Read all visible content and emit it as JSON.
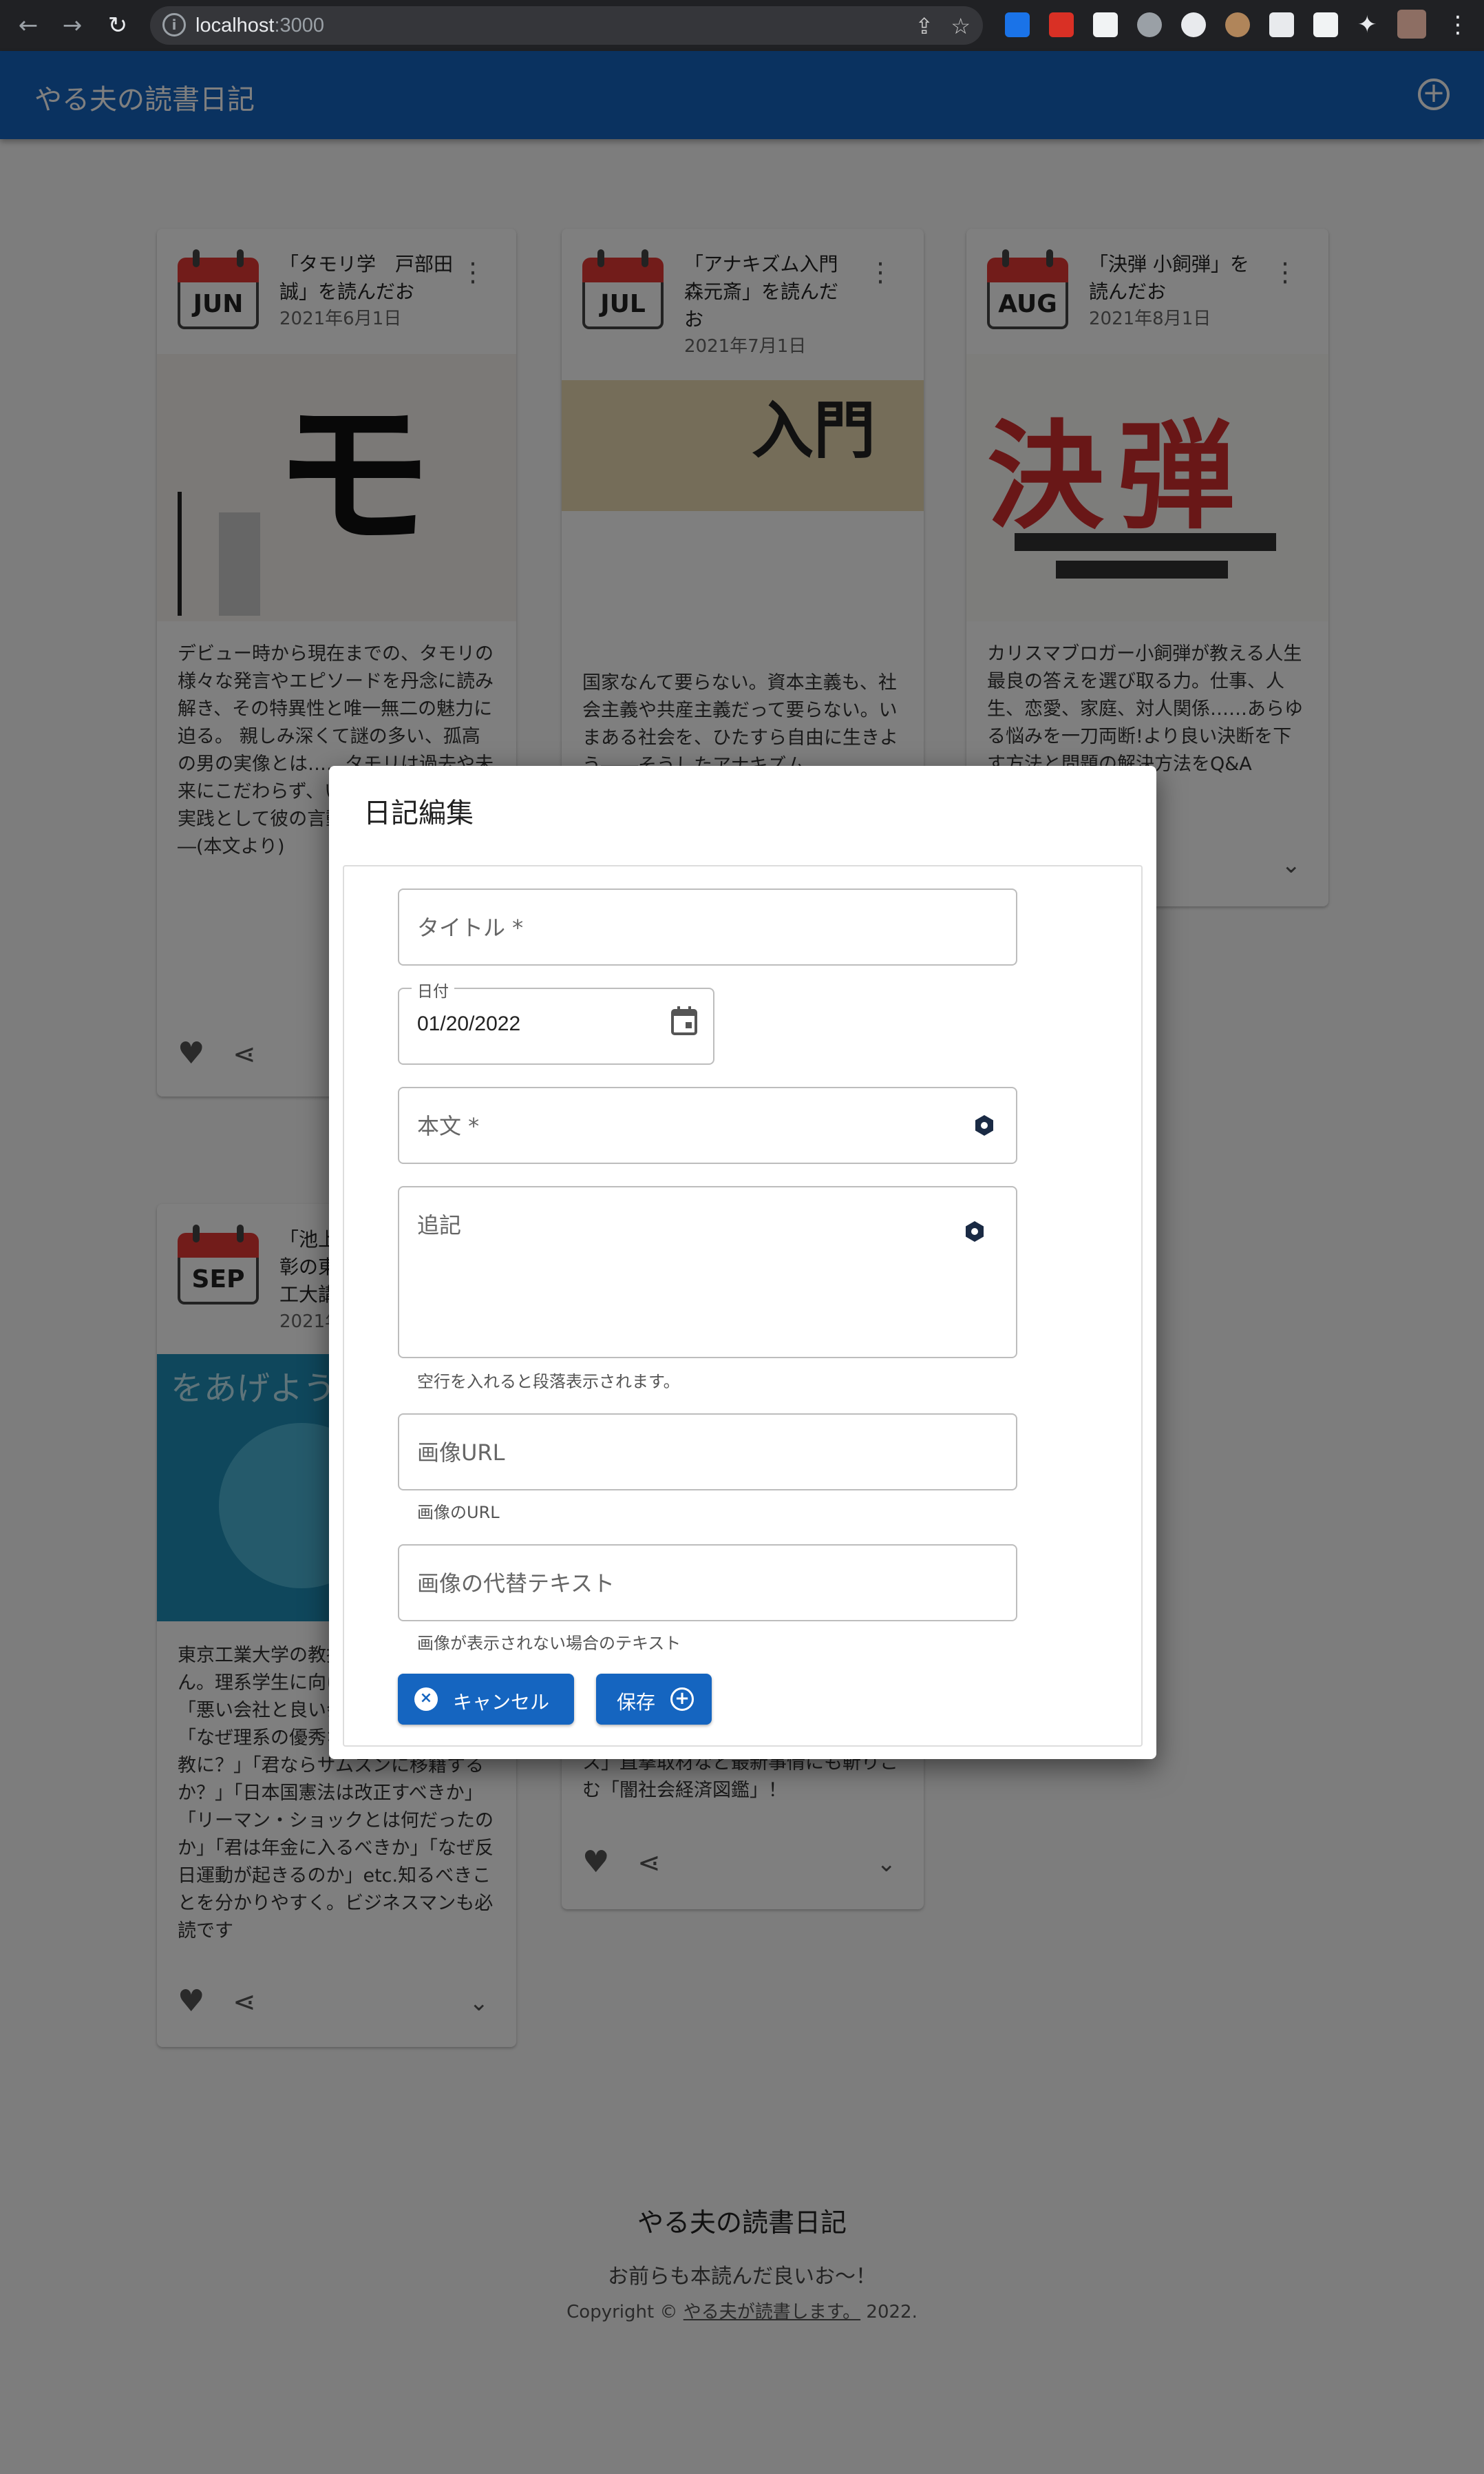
{
  "browser": {
    "url_host": "localhost",
    "url_port": ":3000"
  },
  "appbar": {
    "title": "やる夫の読書日記"
  },
  "cards": [
    {
      "month": "JUN",
      "title": "「タモリ学　戸部田誠」を読んだお",
      "date": "2021年6月1日",
      "description": "デビュー時から現在までの、タモリの様々な発言やエピソードを丹念に読み解き、その特異性と唯一無二の魅力に迫る。 親しみ深くて謎の多い、孤高の男の実像とは……タモリは過去や未来にこだわらず、いまを生きる。その実践として彼の言動の数々がある。―(本文より)"
    },
    {
      "month": "JUL",
      "title": "「アナキズム入門　森元斎」を読んだお",
      "date": "2021年7月1日",
      "description": "国家なんて要らない。資本主義も、社会主義や共産主義だって要らない。いまある社会を、ひたすら自由に生きよう――そうしたアナキズム"
    },
    {
      "month": "AUG",
      "title": "「決弾 小飼弾」を読んだお",
      "date": "2021年8月1日",
      "description": "カリスマブロガー小飼弾が教える人生最良の答えを選び取る力。仕事、人生、恋愛、家庭、対人関係……あらゆる悩みを一刀両断!より良い決断を下す方法と問題の解決方法をQ&A"
    },
    {
      "month": "SEP",
      "title": "「池上彰の東工大講義」を読んだお",
      "date": "2021年9月1日",
      "description": "東京工業大学の教授として池上彰さん。理系学生に向けた講義が一冊に。「悪い会社と良い会社の見分け方」「なぜ理系の優秀な学生がオウム真理教に？」「君ならサムスンに移籍するか？」「日本国憲法は改正すべきか」「リーマン・ショックとは何だったのか」「君は年金に入るべきか」「なぜ反日運動が起きるのか」etc.知るべきことを分かりやすく。ビジネスマンも必読です"
    },
    {
      "description_tail": "ス」直撃取材など最新事情にも斬りこむ「闇社会経済図鑑」！"
    }
  ],
  "dialog": {
    "title": "日記編集",
    "title_field": {
      "placeholder": "タイトル *"
    },
    "date_field": {
      "legend": "日付",
      "value": "01/20/2022"
    },
    "body_field": {
      "placeholder": "本文 *"
    },
    "note_field": {
      "placeholder": "追記",
      "helper": "空行を入れると段落表示されます。"
    },
    "image_url_field": {
      "placeholder": "画像URL",
      "helper": "画像のURL"
    },
    "image_alt_field": {
      "placeholder": "画像の代替テキスト",
      "helper": "画像が表示されない場合のテキスト"
    },
    "cancel_label": "キャンセル",
    "save_label": "保存"
  },
  "footer": {
    "title": "やる夫の読書日記",
    "subtitle": "お前らも本読んだ良いお～！",
    "copyright_prefix": "Copyright ©",
    "copyright_link": "やる夫が読書します。",
    "copyright_year": "2022."
  },
  "colors": {
    "primary": "#1565c0",
    "calendar_red": "#e53935"
  }
}
